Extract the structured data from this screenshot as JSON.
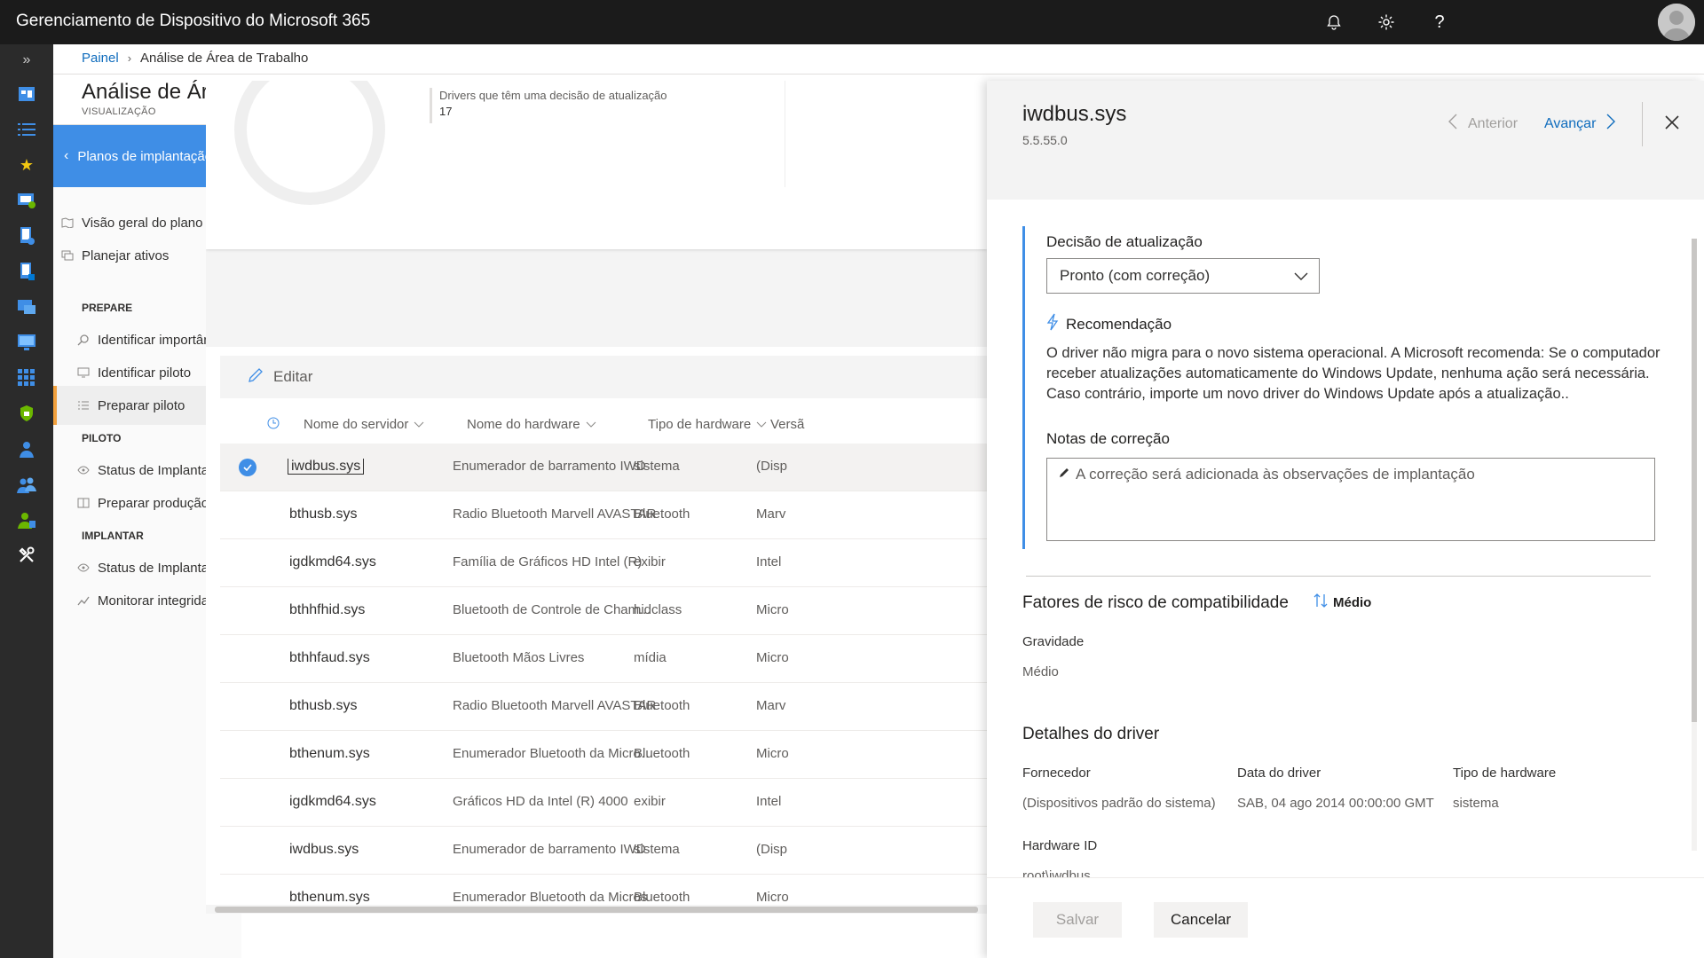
{
  "app": {
    "title": "Gerenciamento de Dispositivo do Microsoft 365"
  },
  "breadcrumb": {
    "root": "Painel",
    "current": "Análise de Área de Trabalho"
  },
  "page": {
    "title": "Análise de Área de Trabalho",
    "subtitle": "VISUALIZAÇÃO"
  },
  "nav": {
    "plans_button": "Planos de implantação",
    "items": [
      {
        "label": "Visão geral do plano"
      },
      {
        "label": "Planejar ativos"
      },
      {
        "label": "Identificar importância"
      },
      {
        "label": "Identificar piloto"
      },
      {
        "label": "Preparar piloto"
      },
      {
        "label": "Status de Implantação"
      },
      {
        "label": "Preparar produção"
      },
      {
        "label": "Status de Implantação"
      },
      {
        "label": "Monitorar integridade"
      }
    ],
    "sections": {
      "prepare": "PREPARE",
      "pilot": "PILOTO",
      "deploy": "IMPLANTAR"
    }
  },
  "summary": {
    "metric_label": "Drivers que têm uma decisão de atualização",
    "metric_value": "17"
  },
  "toolbar": {
    "edit_label": "Editar"
  },
  "table": {
    "columns": [
      "Nome do servidor",
      "Nome do hardware",
      "Tipo de hardware",
      "Versã"
    ],
    "rows": [
      {
        "name": "iwdbus.sys",
        "hardware": "Enumerador de barramento IWD",
        "type": "sistema",
        "version": "(Disp"
      },
      {
        "name": "bthusb.sys",
        "hardware": "Radio Bluetooth Marvell AVASTAR",
        "type": "Bluetooth",
        "version": "Marv"
      },
      {
        "name": "igdkmd64.sys",
        "hardware": "Família de Gráficos HD Intel (R)",
        "type": "exibir",
        "version": "Intel"
      },
      {
        "name": "bthhfhid.sys",
        "hardware": "Bluetooth de Controle de Cham...",
        "type": "hidclass",
        "version": "Micro"
      },
      {
        "name": "bthhfaud.sys",
        "hardware": "Bluetooth Mãos Livres",
        "type": "mídia",
        "version": "Micro"
      },
      {
        "name": "bthusb.sys",
        "hardware": "Radio Bluetooth Marvell AVASTAR",
        "type": "Bluetooth",
        "version": "Marv"
      },
      {
        "name": "bthenum.sys",
        "hardware": "Enumerador Bluetooth da Microsoft",
        "type": "Bluetooth",
        "version": "Micro"
      },
      {
        "name": "igdkmd64.sys",
        "hardware": "Gráficos HD da Intel (R) 4000",
        "type": "exibir",
        "version": "Intel"
      },
      {
        "name": "iwdbus.sys",
        "hardware": "Enumerador de barramento IWD",
        "type": "sistema",
        "version": "(Disp"
      },
      {
        "name": "bthenum.sys",
        "hardware": "Enumerador Bluetooth da Micros",
        "type": "Bluetooth",
        "version": "Micro"
      }
    ]
  },
  "panel": {
    "title": "iwdbus.sys",
    "version": "5.5.55.0",
    "prev_label": "Anterior",
    "next_label": "Avançar",
    "decision_label": "Decisão de atualização",
    "decision_value": "Pronto (com correção)",
    "recommendation_title": "Recomendação",
    "recommendation_text": "O driver não migra para o novo sistema operacional. A Microsoft recomenda: Se o computador receber atualizações automaticamente do Windows Update, nenhuma ação será necessária. Caso contrário, importe um novo driver do Windows Update após a atualização..",
    "notes_label": "Notas de correção",
    "notes_placeholder": "A correção será adicionada às observações de implantação",
    "risk_title": "Fatores de risco de compatibilidade",
    "risk_level": "Médio",
    "severity_label": "Gravidade",
    "severity_value": "Médio",
    "driver_details_title": "Detalhes do driver",
    "vendor_label": "Fornecedor",
    "vendor_value": "(Dispositivos padrão do sistema)",
    "date_label": "Data do driver",
    "date_value": "SAB, 04 ago 2014 00:00:00 GMT",
    "hwtype_label": "Tipo de hardware",
    "hwtype_value": "sistema",
    "hwid_label": "Hardware ID",
    "hwid_value": "root\\iwdbus",
    "save_label": "Salvar",
    "cancel_label": "Cancelar"
  },
  "colors": {
    "accent": "#3f8ee6",
    "link": "#0f6cbd",
    "active_marker": "#f2a13d",
    "topbar": "#1b1b1b",
    "rail": "#2b2b2b"
  }
}
